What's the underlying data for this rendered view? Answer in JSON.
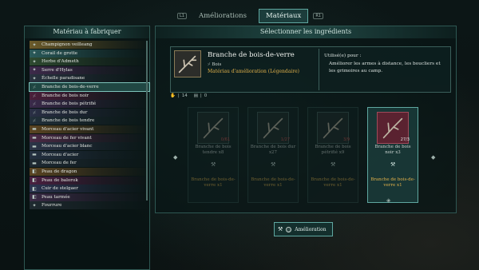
{
  "tabs": {
    "left_key": "L1",
    "right_key": "R1",
    "items": [
      "Améliorations",
      "Matériaux"
    ],
    "active": "Matériaux"
  },
  "left_panel": {
    "title": "Matériau à fabriquer",
    "items": [
      {
        "label": "Champignon veilleang",
        "icon": "mushroom-icon",
        "color": "#6b5a2a"
      },
      {
        "label": "Corail de grotte",
        "icon": "coral-icon",
        "color": "#2a5a5a"
      },
      {
        "label": "Herbe d'Admeth",
        "icon": "herb-icon",
        "color": "#2e4a30"
      },
      {
        "label": "Serre d'Hylas",
        "icon": "claw-icon",
        "color": "#3d2a4a"
      },
      {
        "label": "Échelle paradisane",
        "icon": "scale-icon",
        "color": "#2a3340"
      },
      {
        "label": "Branche de bois-de-verre",
        "icon": "branch-icon",
        "color": "#3d7a70",
        "selected": true
      },
      {
        "label": "Branche de bois noir",
        "icon": "branch-icon",
        "color": "#4a1f3a"
      },
      {
        "label": "Branche de bois pétrifié",
        "icon": "branch-icon",
        "color": "#3a2a4a"
      },
      {
        "label": "Branche de bois dur",
        "icon": "branch-icon",
        "color": "#2a2f45"
      },
      {
        "label": "Branche de bois tendre",
        "icon": "branch-icon",
        "color": "#22303a"
      },
      {
        "label": "Morceau d'acier vivant",
        "icon": "ingot-icon",
        "color": "#5a4422"
      },
      {
        "label": "Morceau de fer vivant",
        "icon": "ingot-icon",
        "color": "#4a2a45"
      },
      {
        "label": "Morceau d'acier blanc",
        "icon": "ingot-icon",
        "color": "#2c3548"
      },
      {
        "label": "Morceau d'acier",
        "icon": "ingot-icon",
        "color": "#243040"
      },
      {
        "label": "Morceau de fer",
        "icon": "ingot-icon",
        "color": "#1f2a33"
      },
      {
        "label": "Peau de dragon",
        "icon": "hide-icon",
        "color": "#5a4422"
      },
      {
        "label": "Peau de balorok",
        "icon": "hide-icon",
        "color": "#4a2040"
      },
      {
        "label": "Cuir de stelgaer",
        "icon": "hide-icon",
        "color": "#2d3450"
      },
      {
        "label": "Peau tarmée",
        "icon": "hide-icon",
        "color": "#3a2a45"
      },
      {
        "label": "Fourrure",
        "icon": "fur-icon",
        "color": "#1f2a30"
      }
    ]
  },
  "right_panel": {
    "title": "Sélectionner les ingrédients",
    "item": {
      "name": "Branche de bois-de-verre",
      "type": "Bois",
      "material": "Matériau d'amélioration (Légendaire)",
      "use_label": "Utilisé(e) pour :",
      "description": "Améliorer les armes à distance, les boucliers et les grimoires au camp."
    },
    "stats": [
      {
        "icon": "hand-icon",
        "value": "14"
      },
      {
        "icon": "chest-icon",
        "value": "0"
      }
    ],
    "cards": [
      {
        "name": "Branche de bois tendre x8",
        "count": "0/61",
        "result": "Branche de bois-de-verre x1",
        "state": "dim"
      },
      {
        "name": "Branche de bois dur x27",
        "count": "1/27",
        "result": "Branche de bois-de-verre x1",
        "state": "dim"
      },
      {
        "name": "Branche de bois pétrifié x9",
        "count": "3/9",
        "result": "Branche de bois-de-verre x1",
        "state": "dim"
      },
      {
        "name": "Branche de bois noir x3",
        "count": "27/3",
        "result": "Branche de bois-de-verre x1",
        "state": "active"
      }
    ]
  },
  "upgrade_button": {
    "label": "Amélioration"
  }
}
